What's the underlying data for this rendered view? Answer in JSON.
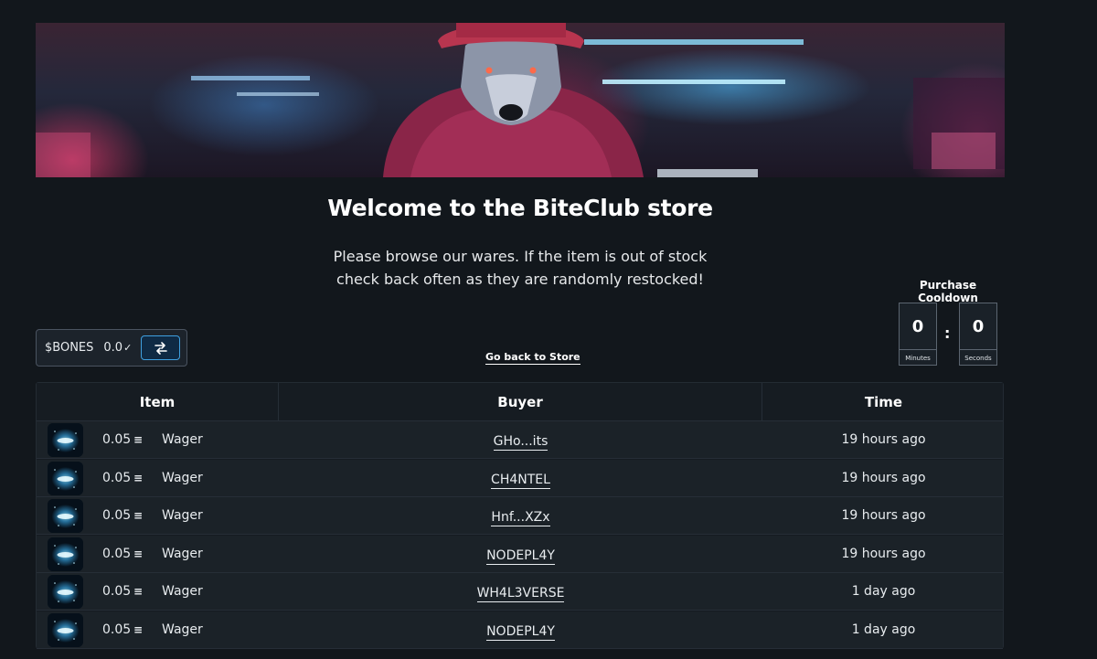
{
  "store": {
    "title": "Welcome to the BiteClub store",
    "subtitle": "Please browse our wares. If the item is out of stock check back often as they are randomly restocked!"
  },
  "wallet": {
    "currency_label": "$BONES",
    "balance": "0.0",
    "balance_icon": "check-mark-icon",
    "swap_icon": "swap-arrows-icon",
    "accent_color": "#3fa0e0"
  },
  "navigation": {
    "back_link": "Go back to Store"
  },
  "cooldown": {
    "title": "Purchase Cooldown",
    "minutes": "0",
    "minutes_label": "Minutes",
    "separator": ":",
    "seconds": "0",
    "seconds_label": "Seconds"
  },
  "table": {
    "headers": {
      "item": "Item",
      "buyer": "Buyer",
      "time": "Time"
    },
    "rows": [
      {
        "amount": "0.05",
        "currency_icon": "sol-icon",
        "name": "Wager",
        "buyer": "GHo...its",
        "time": "19 hours ago"
      },
      {
        "amount": "0.05",
        "currency_icon": "sol-icon",
        "name": "Wager",
        "buyer": "CH4NTEL",
        "time": "19 hours ago"
      },
      {
        "amount": "0.05",
        "currency_icon": "sol-icon",
        "name": "Wager",
        "buyer": "Hnf...XZx",
        "time": "19 hours ago"
      },
      {
        "amount": "0.05",
        "currency_icon": "sol-icon",
        "name": "Wager",
        "buyer": "NODEPL4Y",
        "time": "19 hours ago"
      },
      {
        "amount": "0.05",
        "currency_icon": "sol-icon",
        "name": "Wager",
        "buyer": "WH4L3VERSE",
        "time": "1 day ago"
      },
      {
        "amount": "0.05",
        "currency_icon": "sol-icon",
        "name": "Wager",
        "buyer": "NODEPL4Y",
        "time": "1 day ago"
      }
    ]
  }
}
